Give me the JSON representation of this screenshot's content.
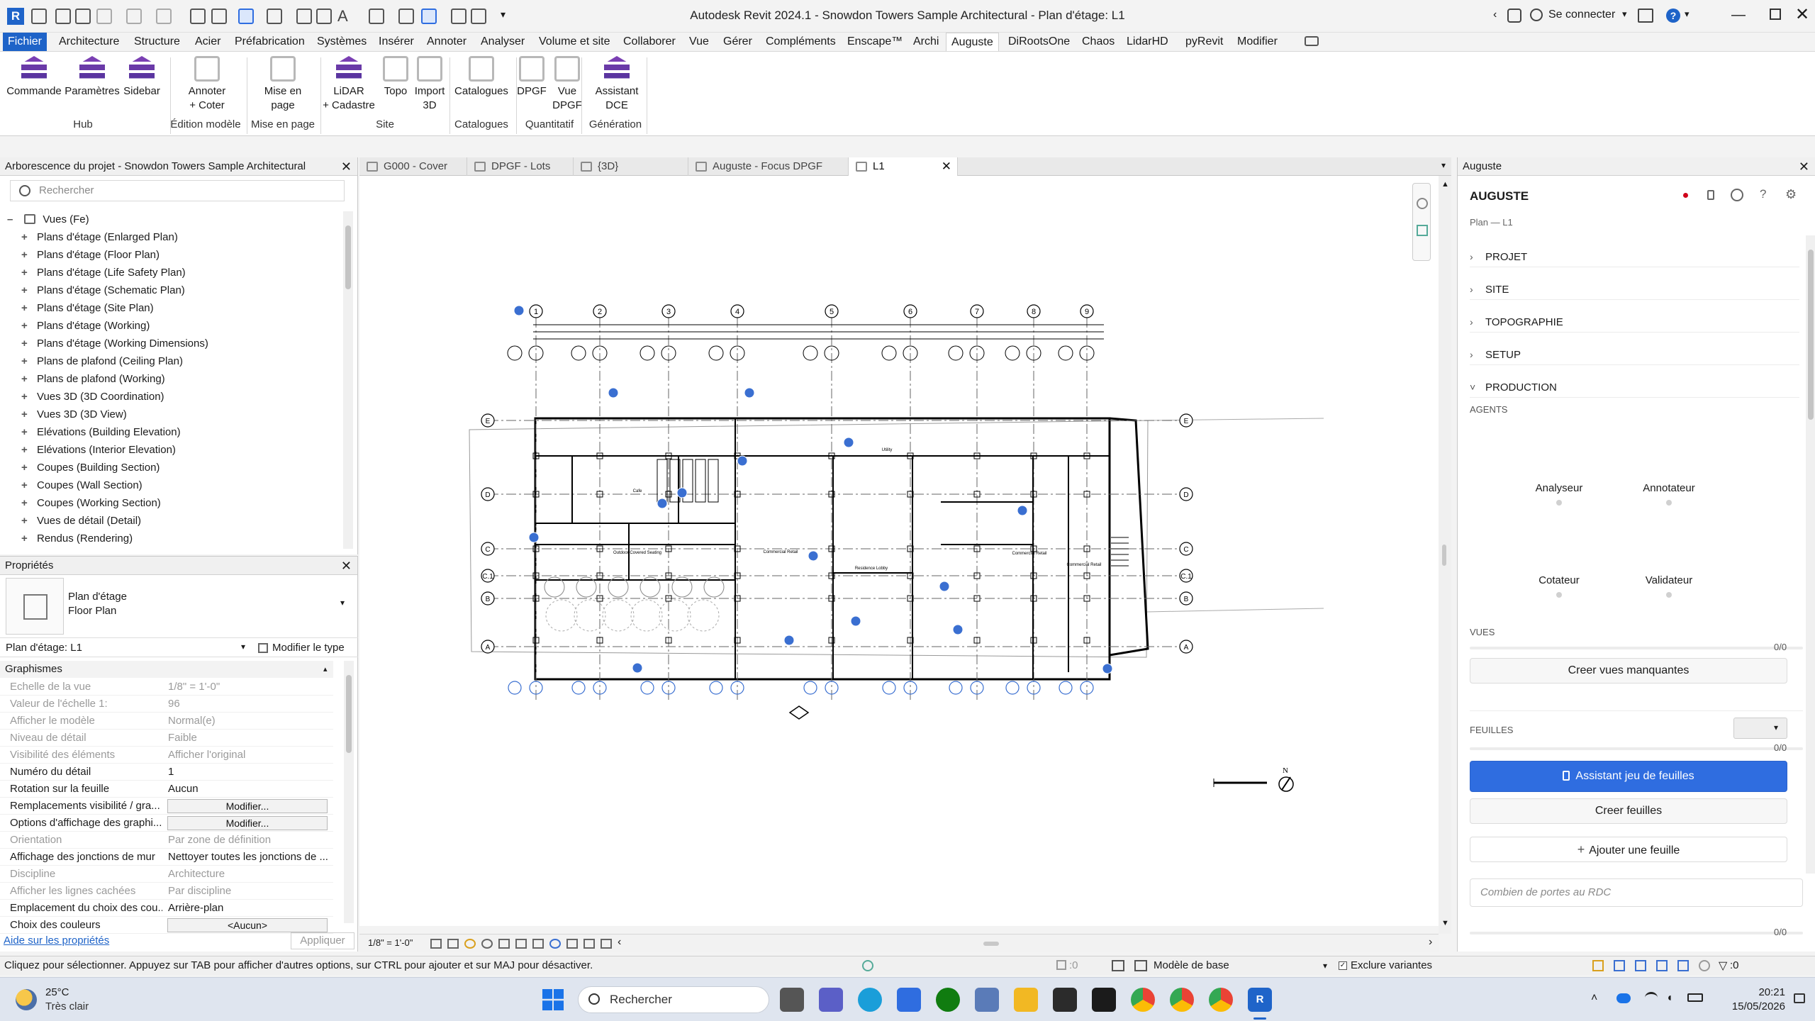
{
  "window": {
    "title": "Autodesk Revit 2024.1 - Snowdon Towers Sample Architectural - Plan d'étage: L1",
    "app_logo": "R",
    "signin": "Se connecter"
  },
  "menu": [
    "Fichier",
    "Architecture",
    "Structure",
    "Acier",
    "Préfabrication",
    "Systèmes",
    "Insérer",
    "Annoter",
    "Analyser",
    "Volume et site",
    "Collaborer",
    "Vue",
    "Gérer",
    "Compléments",
    "Enscape™",
    "Archi",
    "Auguste",
    "DiRootsOne",
    "Chaos",
    "LidarHD",
    "pyRevit",
    "Modifier"
  ],
  "menu_active": "Auguste",
  "ribbon": {
    "buttons": [
      {
        "l1": "Commande",
        "l2": "",
        "l3": "",
        "icon": "hub-icon"
      },
      {
        "l1": "Paramètres",
        "l2": "",
        "l3": "",
        "icon": "hub-icon"
      },
      {
        "l1": "Sidebar",
        "l2": "",
        "l3": "",
        "icon": "hub-icon"
      },
      {
        "l1": "Annoter",
        "l2": "+ Coter",
        "l3": "",
        "icon": "annotate-icon"
      },
      {
        "l1": "Mise en",
        "l2": "page",
        "l3": "",
        "icon": "layout-icon"
      },
      {
        "l1": "LiDAR",
        "l2": "+ Cadastre",
        "l3": "",
        "icon": "hub-icon"
      },
      {
        "l1": "Topo",
        "l2": "",
        "l3": "",
        "icon": "topo-icon"
      },
      {
        "l1": "Import",
        "l2": "3D",
        "l3": "",
        "icon": "import-icon"
      },
      {
        "l1": "Catalogues",
        "l2": "",
        "l3": "",
        "icon": "catalog-icon"
      },
      {
        "l1": "DPGF",
        "l2": "",
        "l3": "",
        "icon": "dpgf-icon"
      },
      {
        "l1": "Vue",
        "l2": "DPGF",
        "l3": "",
        "icon": "dpgf-view-icon"
      },
      {
        "l1": "Assistant",
        "l2": "DCE",
        "l3": "",
        "icon": "hub-icon"
      }
    ],
    "groups": [
      "Hub",
      "Édition modèle",
      "Mise en page",
      "Site",
      "Catalogues",
      "Quantitatif",
      "Génération"
    ]
  },
  "project_browser": {
    "title": "Arborescence du projet - Snowdon Towers Sample Architectural",
    "search_placeholder": "Rechercher",
    "root": "Vues (Fe)",
    "items": [
      "Plans d'étage (Enlarged Plan)",
      "Plans d'étage (Floor Plan)",
      "Plans d'étage (Life Safety Plan)",
      "Plans d'étage (Schematic Plan)",
      "Plans d'étage (Site Plan)",
      "Plans d'étage (Working)",
      "Plans d'étage (Working Dimensions)",
      "Plans de plafond (Ceiling Plan)",
      "Plans de plafond (Working)",
      "Vues 3D (3D Coordination)",
      "Vues 3D (3D View)",
      "Elévations (Building Elevation)",
      "Elévations (Interior Elevation)",
      "Coupes (Building Section)",
      "Coupes (Wall Section)",
      "Coupes (Working Section)",
      "Vues de détail (Detail)",
      "Rendus (Rendering)"
    ]
  },
  "properties": {
    "title": "Propriétés",
    "type_line1": "Plan d'étage",
    "type_line2": "Floor Plan",
    "instance": "Plan d'étage: L1",
    "edit_type": "Modifier le type",
    "group": "Graphismes",
    "rows": [
      {
        "k": "Echelle de la vue",
        "v": "1/8\" = 1'-0\"",
        "dim": true,
        "btn": false
      },
      {
        "k": "Valeur de l'échelle    1:",
        "v": "96",
        "dim": true,
        "btn": false
      },
      {
        "k": "Afficher le modèle",
        "v": "Normal(e)",
        "dim": true,
        "btn": false
      },
      {
        "k": "Niveau de détail",
        "v": "Faible",
        "dim": true,
        "btn": false
      },
      {
        "k": "Visibilité des éléments",
        "v": "Afficher l'original",
        "dim": true,
        "btn": false
      },
      {
        "k": "Numéro du détail",
        "v": "1",
        "dim": false,
        "btn": false
      },
      {
        "k": "Rotation sur la feuille",
        "v": "Aucun",
        "dim": false,
        "btn": false
      },
      {
        "k": "Remplacements visibilité / gra...",
        "v": "Modifier...",
        "dim": false,
        "btn": true
      },
      {
        "k": "Options d'affichage des graphi...",
        "v": "Modifier...",
        "dim": false,
        "btn": true
      },
      {
        "k": "Orientation",
        "v": "Par zone de définition",
        "dim": true,
        "btn": false
      },
      {
        "k": "Affichage des jonctions de mur",
        "v": "Nettoyer toutes les jonctions de ...",
        "dim": false,
        "btn": false
      },
      {
        "k": "Discipline",
        "v": "Architecture",
        "dim": true,
        "btn": false
      },
      {
        "k": "Afficher les lignes cachées",
        "v": "Par discipline",
        "dim": true,
        "btn": false
      },
      {
        "k": "Emplacement du choix des cou...",
        "v": "Arrière-plan",
        "dim": false,
        "btn": false
      },
      {
        "k": "Choix des couleurs",
        "v": "<Aucun>",
        "dim": false,
        "btn": true
      }
    ],
    "help": "Aide sur les propriétés",
    "apply": "Appliquer"
  },
  "view_tabs": [
    {
      "label": "G000 - Cover",
      "active": false
    },
    {
      "label": "DPGF - Lots",
      "active": false
    },
    {
      "label": "{3D}",
      "active": false
    },
    {
      "label": "Auguste - Focus DPGF",
      "active": false
    },
    {
      "label": "L1",
      "active": true
    }
  ],
  "drawing": {
    "grid_top": [
      "1",
      "2",
      "3",
      "4",
      "5",
      "6",
      "7",
      "8",
      "9"
    ],
    "grid_left": [
      "E",
      "D",
      "C",
      "C.1",
      "B",
      "A"
    ],
    "labels": [
      "Commercial Retail",
      "Commercial Retail",
      "Residence Lobby",
      "Commercial Retail",
      "Outdoor Covered Seating",
      "Cafe",
      "Utility"
    ],
    "north": "N"
  },
  "view_scale": "1/8\" = 1'-0\"",
  "auguste": {
    "header": "Auguste",
    "title": "AUGUSTE",
    "subtitle": "Plan — L1",
    "sections": [
      "PROJET",
      "SITE",
      "TOPOGRAPHIE",
      "SETUP",
      "PRODUCTION"
    ],
    "agents_label": "AGENTS",
    "agents": [
      "Analyseur",
      "Annotateur",
      "Cotateur",
      "Validateur"
    ],
    "vues_label": "VUES",
    "vues_count": "0/0",
    "vues_btn": "Creer vues manquantes",
    "feuilles_label": "FEUILLES",
    "feuilles_count": "0/0",
    "assistant_btn": "Assistant jeu de feuilles",
    "creer_feuilles_btn": "Creer feuilles",
    "ajouter_btn": "Ajouter une feuille",
    "prompt_placeholder": "Combien de portes au RDC",
    "prompt_count": "0/0"
  },
  "status": {
    "hint": "Cliquez pour sélectionner. Appuyez sur TAB pour afficher d'autres options, sur CTRL pour ajouter et sur MAJ pour désactiver.",
    "selection_count": ":0",
    "model": "Modèle de base",
    "exclude": "Exclure variantes",
    "filter_count": ":0"
  },
  "taskbar": {
    "temp": "25°C",
    "weather": "Très clair",
    "search": "Rechercher",
    "time": "20:21",
    "date": "15/05/2026"
  },
  "colors": {
    "accent": "#1e63c8",
    "primary_btn": "#2f6de0",
    "record_dot": "#d0021b",
    "grid_blue": "#3a6fd1"
  }
}
